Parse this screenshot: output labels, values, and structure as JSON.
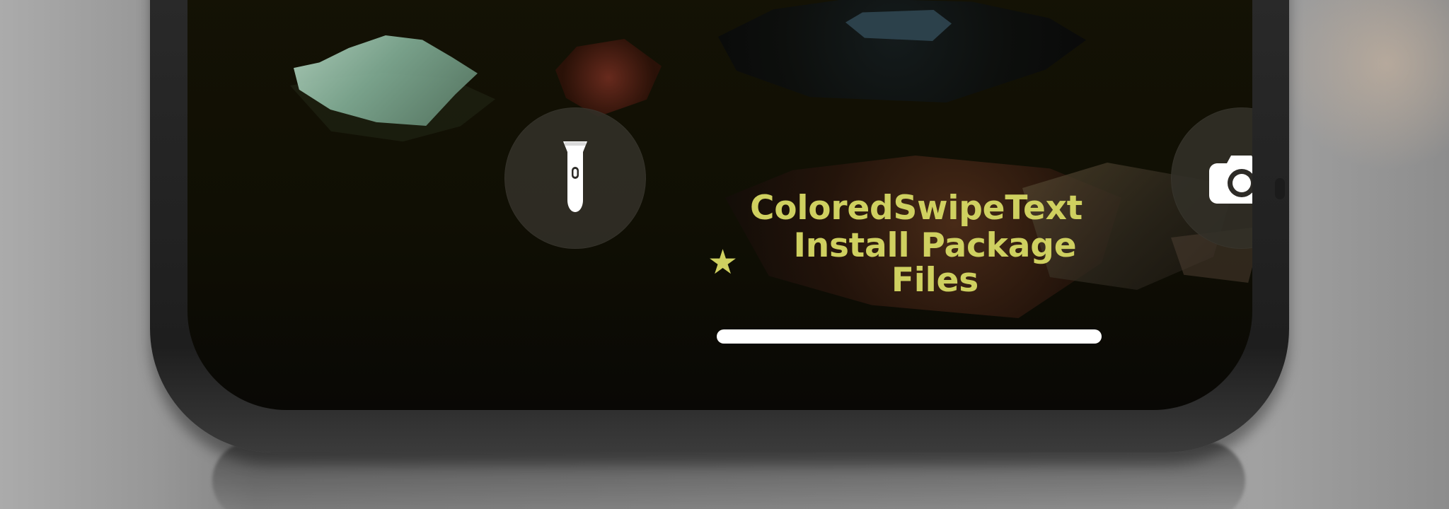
{
  "lock_screen": {
    "message_title": "ColoredSwipeText",
    "message_subtitle": "Install Package Files",
    "icons": {
      "flashlight": "flashlight-icon",
      "camera": "camera-icon",
      "star": "star-icon"
    },
    "colors": {
      "message_text": "#CFD060",
      "home_indicator": "#FFFFFF",
      "quick_action_background": "#32302B",
      "screen_background": "#120F05"
    }
  }
}
